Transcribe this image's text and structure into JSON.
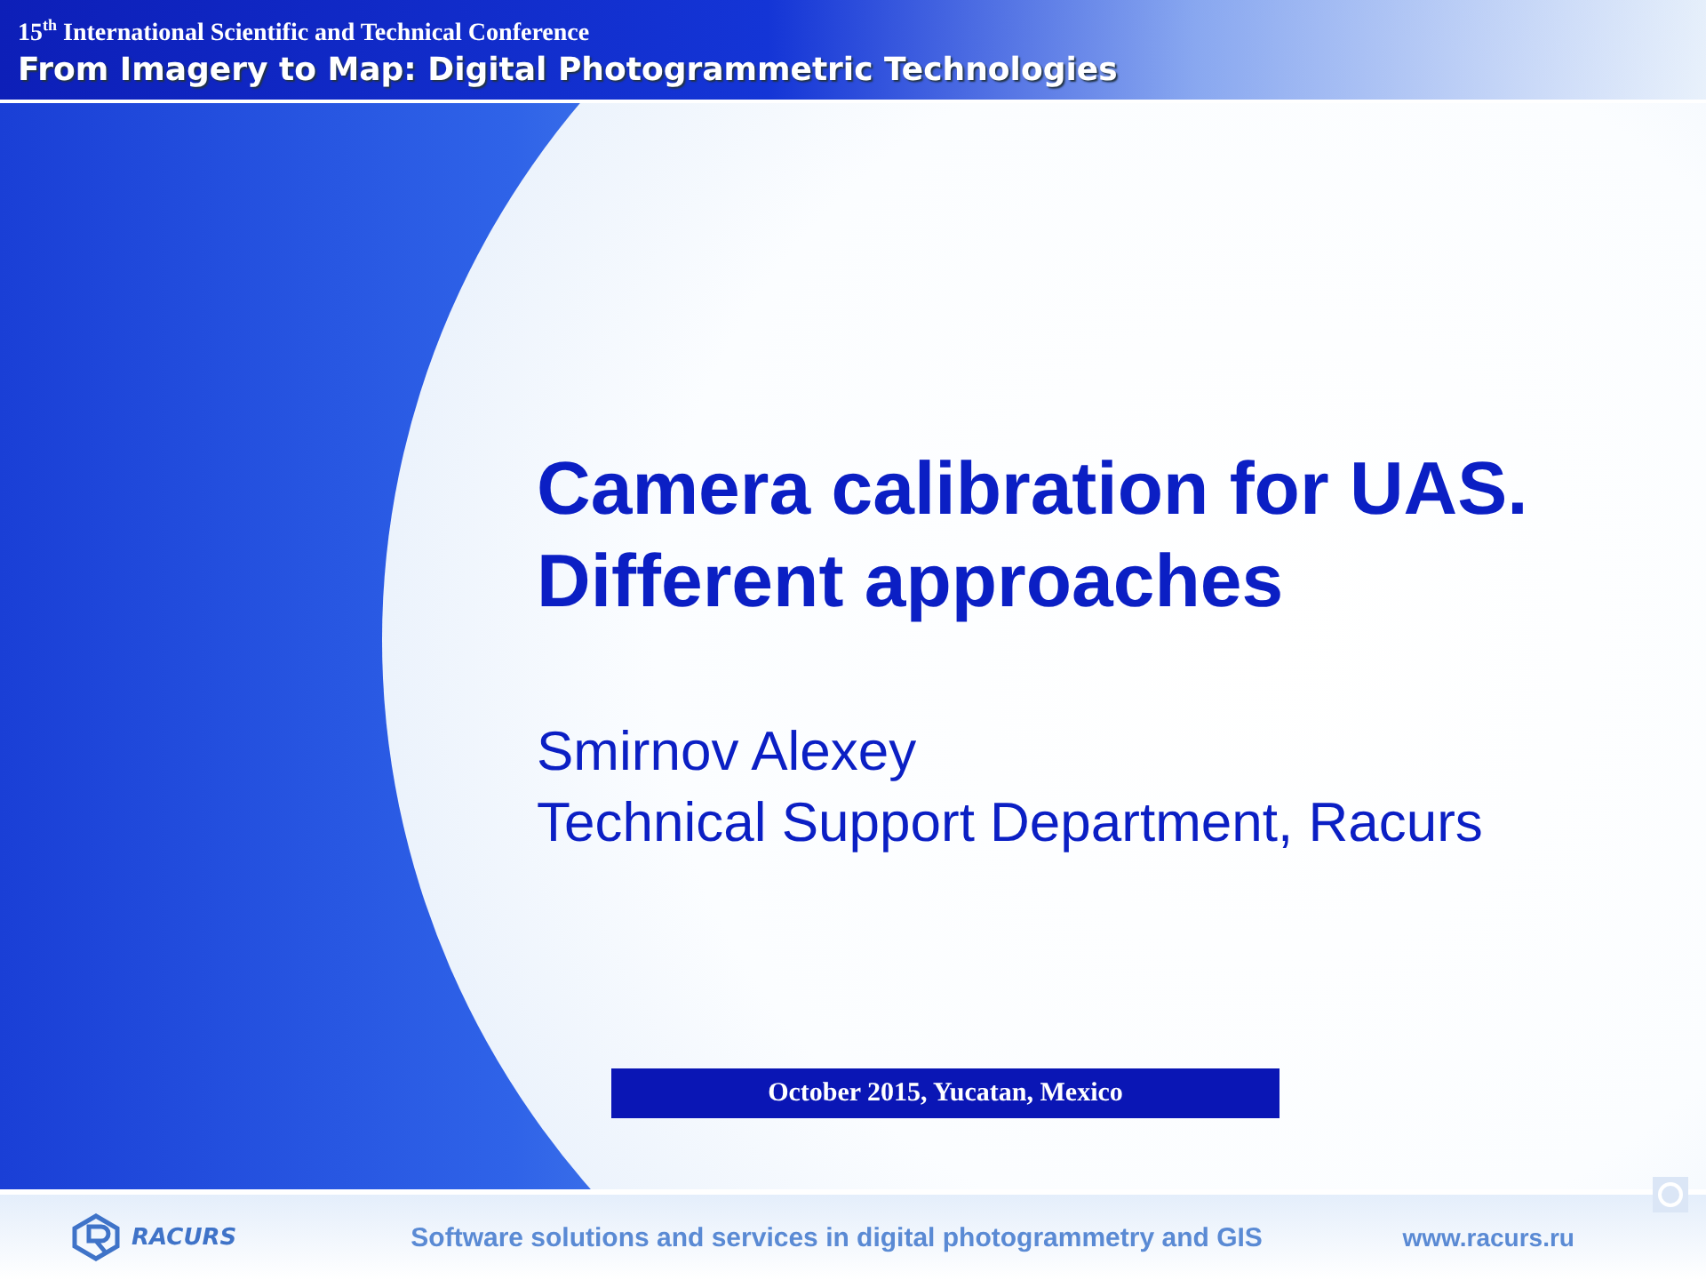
{
  "header": {
    "conference": "15$^{th}$ International Scientific and Technical Conference",
    "title": "From Imagery to Map: Digital Photogrammetric Technologies"
  },
  "slide": {
    "title_lines": [
      "Camera calibration for UAS.",
      "Different approaches"
    ],
    "author": "Smirnov Alexey",
    "affiliation": "Technical Support Department, Racurs",
    "date_place": "October 2015, Yucatan, Mexico"
  },
  "footer": {
    "logo": "RACURS",
    "tagline": "Software solutions and services in digital photogrammetry and GIS",
    "url": "www.racurs.ru"
  }
}
